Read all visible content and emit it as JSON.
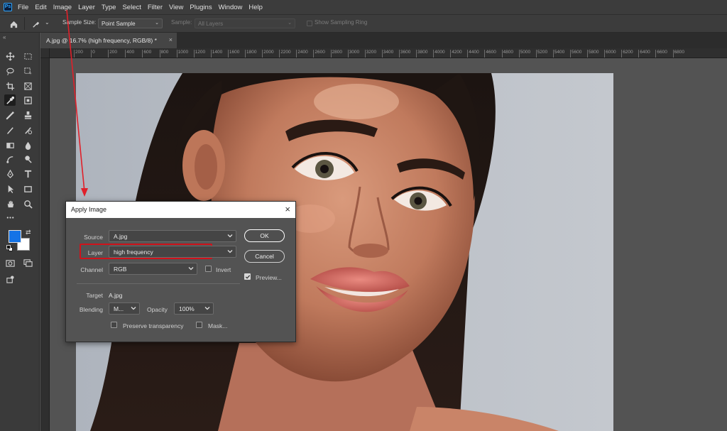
{
  "app": {
    "logo": "Ps"
  },
  "menu": [
    "File",
    "Edit",
    "Image",
    "Layer",
    "Type",
    "Select",
    "Filter",
    "View",
    "Plugins",
    "Window",
    "Help"
  ],
  "options": {
    "sample_size_label": "Sample Size:",
    "sample_size_value": "Point Sample",
    "sample_label": "Sample:",
    "sample_value": "All Layers",
    "show_ring_label": "Show Sampling Ring"
  },
  "document_tab": {
    "title": "A.jpg @ 16.7% (high frequency, RGB/8) *",
    "close": "×"
  },
  "ruler_ticks": [
    "200",
    "0",
    "200",
    "400",
    "600",
    "800",
    "1000",
    "1200",
    "1400",
    "1600",
    "1800",
    "2000",
    "2200",
    "2400",
    "2600",
    "2800",
    "3000",
    "3200",
    "3400",
    "3600",
    "3800",
    "4000",
    "4200",
    "4400",
    "4600",
    "4800",
    "5000",
    "5200",
    "5400",
    "5600",
    "5800",
    "6000",
    "6200",
    "6400",
    "6600",
    "6800"
  ],
  "colors": {
    "foreground": "#1473e6",
    "background": "#ffffff",
    "highlight": "#d0121b"
  },
  "dialog": {
    "title": "Apply Image",
    "close": "×",
    "source_label": "Source",
    "source_value": "A.jpg",
    "layer_label": "Layer",
    "layer_value": "high frequency",
    "channel_label": "Channel",
    "channel_value": "RGB",
    "invert_label": "Invert",
    "target_label": "Target",
    "target_value": "A.jpg",
    "blending_label": "Blending",
    "blending_value": "M...",
    "opacity_label": "Opacity",
    "opacity_value": "100%",
    "preserve_label": "Preserve transparency",
    "mask_label": "Mask...",
    "ok_label": "OK",
    "cancel_label": "Cancel",
    "preview_label": "Preview...",
    "preview_checked": true,
    "invert_checked": false,
    "preserve_checked": false,
    "mask_checked": false
  }
}
